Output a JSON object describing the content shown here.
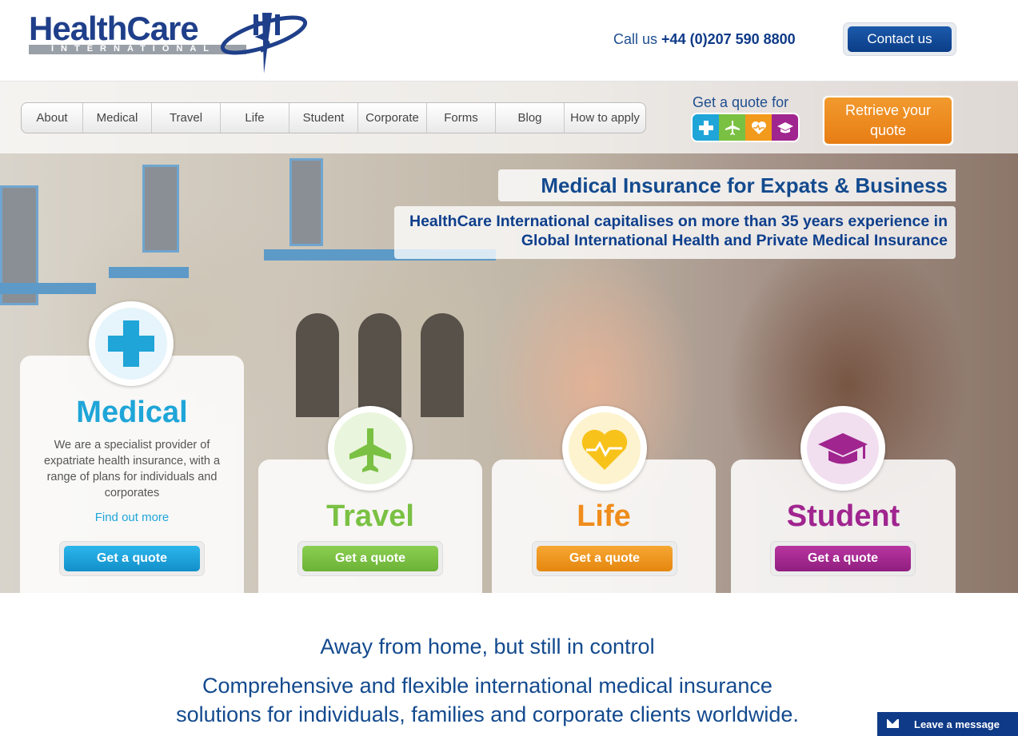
{
  "brand": {
    "logo_text": "HealthCare",
    "logo_sub": "INTERNATIONAL",
    "colors": {
      "navy": "#134a8e",
      "medical": "#1fa5d8",
      "travel": "#7ac143",
      "life": "#f29a1b",
      "student": "#a0258f",
      "orange": "#ef8c21"
    }
  },
  "header": {
    "call_prefix": "Call us",
    "phone": "+44 (0)207 590 8800",
    "contact_label": "Contact us"
  },
  "nav": {
    "items": [
      {
        "label": "About"
      },
      {
        "label": "Medical"
      },
      {
        "label": "Travel"
      },
      {
        "label": "Life"
      },
      {
        "label": "Student"
      },
      {
        "label": "Corporate"
      },
      {
        "label": "Forms"
      },
      {
        "label": "Blog"
      },
      {
        "label": "How to apply"
      }
    ]
  },
  "quote": {
    "label": "Get a quote for",
    "icons": [
      "medical-cross-icon",
      "plane-icon",
      "heart-icon",
      "graduation-cap-icon"
    ],
    "retrieve_line1": "Retrieve your",
    "retrieve_line2": "quote"
  },
  "hero": {
    "headline": "Medical Insurance for Expats & Business",
    "subhead_line1": "HealthCare International capitalises on more than 35 years experience in",
    "subhead_line2": "Global International Health and Private Medical Insurance"
  },
  "cards": [
    {
      "title": "Medical",
      "description": "We are a specialist provider of expatriate health insurance, with a range of plans for individuals and corporates",
      "link": "Find out more",
      "button": "Get a quote",
      "icon": "medical-cross-icon"
    },
    {
      "title": "Travel",
      "button": "Get a quote",
      "icon": "plane-icon"
    },
    {
      "title": "Life",
      "button": "Get a quote",
      "icon": "heart-icon"
    },
    {
      "title": "Student",
      "button": "Get a quote",
      "icon": "graduation-cap-icon"
    }
  ],
  "intro": {
    "tagline": "Away from home, but still in control",
    "line1": "Comprehensive and flexible international medical insurance",
    "line2": "solutions for individuals, families and corporate clients worldwide."
  },
  "chat": {
    "label": "Leave a message",
    "icon": "envelope-icon"
  }
}
